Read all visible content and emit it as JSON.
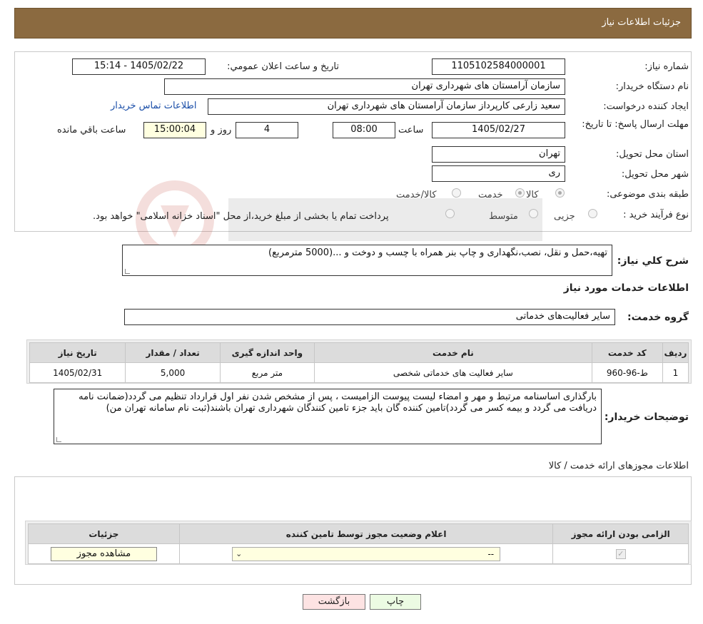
{
  "header": {
    "title": "جزئیات اطلاعات نیاز"
  },
  "form": {
    "need_number_label": "شماره نیاز:",
    "need_number": "1105102584000001",
    "announce_label": "تاریخ و ساعت اعلان عمومي:",
    "announce_value": "1405/02/22 - 15:14",
    "buyer_org_label": "نام دستگاه خريدار:",
    "buyer_org": "سازمان آرامستان های شهرداری تهران",
    "creator_label": "ايجاد کننده درخواست:",
    "creator": "سعید زارعی کارپرداز سازمان آرامستان های شهرداری تهران",
    "contact_link": "اطلاعات تماس خريدار",
    "deadline_label": "مهلت ارسال پاسخ: تا تاريخ:",
    "deadline_date": "1405/02/27",
    "time_label": "ساعت",
    "deadline_time": "08:00",
    "days_value": "4",
    "days_label": "روز و",
    "remaining_time": "15:00:04",
    "remaining_label": "ساعت باقي مانده",
    "province_label": "استان محل تحویل:",
    "province": "تهران",
    "city_label": "شهر محل تحویل:",
    "city": "ری",
    "category_label": "طبقه بندی موضوعی:",
    "category_options": [
      "کالا",
      "خدمت",
      "کالا/خدمت"
    ],
    "process_label": "نوع فرآیند خرید :",
    "process_options": [
      "جزیی",
      "متوسط"
    ],
    "process_note": "پرداخت تمام يا بخشی از مبلغ خريد،از محل \"اسناد خزانه اسلامی\" خواهد بود."
  },
  "summary": {
    "label": "شرح کلي نياز:",
    "text": "تهیه،حمل و نقل، نصب،نگهداری و چاپ بنر همراه با چسب و دوخت و ...(5000 مترمربع)"
  },
  "services": {
    "title": "اطلاعات خدمات مورد نياز",
    "group_label": "گروه خدمت:",
    "group_value": "سایر فعالیت‌های خدماتی",
    "columns": [
      "رديف",
      "کد خدمت",
      "نام خدمت",
      "واحد اندازه گيری",
      "تعداد / مقدار",
      "تاريخ نياز"
    ],
    "rows": [
      {
        "index": "1",
        "code": "ط-96-960",
        "name": "سایر فعالیت های خدماتی شخصی",
        "unit": "متر مربع",
        "qty": "5,000",
        "date": "1405/02/31"
      }
    ]
  },
  "buyer_notes": {
    "label": "توضيحات خريدار:",
    "text": "بارگذاری اساسنامه مرتبط و مهر و امضاء لیست پیوست الزامیست ، پس از مشخص شدن نفر اول قرارداد تنظیم می گردد(ضمانت نامه دریافت می گردد و بیمه کسر می گردد)تامین کننده گان باید جزء تامین کنندگان شهرداری تهران باشند(ثبت نام سامانه تهران من)"
  },
  "permits": {
    "title": "اطلاعات مجوزهای ارائه خدمت / کالا",
    "columns": [
      "الزامی بودن ارائه مجوز",
      "اعلام وضعیت مجوز توسط تامین کننده",
      "جزئیات"
    ],
    "select_value": "--",
    "view_button": "مشاهده مجوز"
  },
  "actions": {
    "print": "چاپ",
    "back": "بازگشت"
  },
  "colors": {
    "header": "#8b6a40",
    "back_button": "#fde3e3",
    "print_button": "#ecfbe3"
  }
}
